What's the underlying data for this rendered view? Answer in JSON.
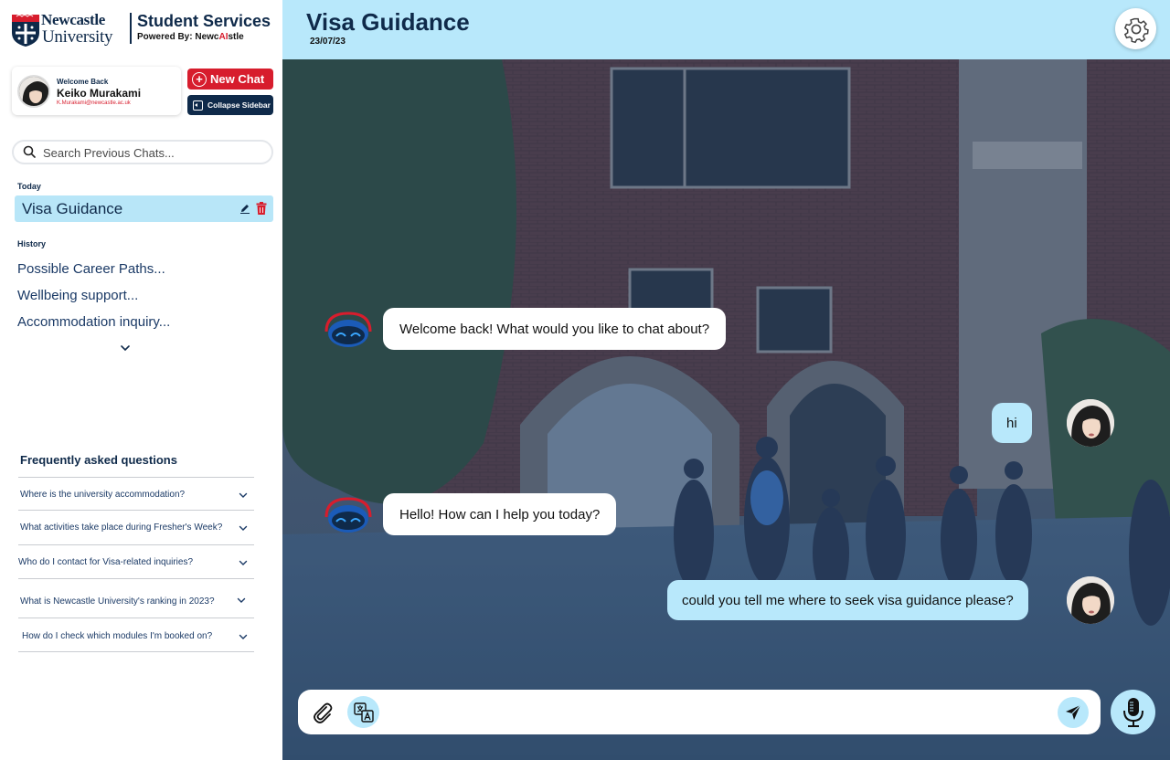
{
  "brand": {
    "logo_line1": "Newcastle",
    "logo_line2": "University",
    "service_title": "Student Services",
    "powered_prefix": "Powered By: ",
    "powered_part1": "Newc",
    "powered_ai": "AI",
    "powered_part2": "stle"
  },
  "user": {
    "welcome": "Welcome Back",
    "name": "Keiko Murakami",
    "email": "K.Murakami@newcastle.ac.uk"
  },
  "buttons": {
    "new_chat": "New Chat",
    "collapse_sidebar": "Collapse Sidebar"
  },
  "search": {
    "placeholder": "Search Previous Chats..."
  },
  "sections": {
    "today": "Today",
    "history": "History"
  },
  "active_chat": {
    "label": "Visa Guidance"
  },
  "history": [
    "Possible Career Paths...",
    "Wellbeing support...",
    "Accommodation inquiry..."
  ],
  "faq": {
    "title": "Frequently asked questions",
    "items": [
      "Where is the university accommodation?",
      "What activities take place during Fresher's Week?",
      "Who do I contact for Visa-related inquiries?",
      "What is Newcastle University's ranking in 2023?",
      "How do I check which modules I'm booked on?"
    ]
  },
  "header": {
    "title": "Visa Guidance",
    "date": "23/07/23"
  },
  "messages": [
    {
      "role": "bot",
      "text": "Welcome back! What would you like to chat about?"
    },
    {
      "role": "user",
      "text": "hi"
    },
    {
      "role": "bot",
      "text": "Hello! How can I help you today?"
    },
    {
      "role": "user",
      "text": "could you tell me where to seek visa guidance please?"
    }
  ],
  "composer": {
    "placeholder": ""
  },
  "colors": {
    "navy": "#0f2a4a",
    "red": "#d71d2d",
    "light_blue": "#b8e8fb"
  },
  "icons": [
    "search-icon",
    "edit-icon",
    "trash-icon",
    "chevron-down-icon",
    "gear-icon",
    "paperclip-icon",
    "translate-icon",
    "send-icon",
    "microphone-icon",
    "collapse-sidebar-icon",
    "plus-circle-icon"
  ]
}
